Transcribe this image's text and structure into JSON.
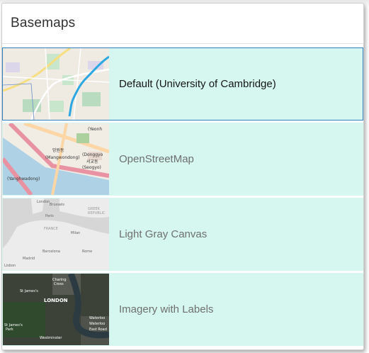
{
  "panel": {
    "title": "Basemaps"
  },
  "basemaps": [
    {
      "label": "Default (University of Cambridge)",
      "selected": true
    },
    {
      "label": "OpenStreetMap",
      "selected": false
    },
    {
      "label": "Light Gray Canvas",
      "selected": false
    },
    {
      "label": "Imagery with Labels",
      "selected": false
    }
  ],
  "thumbnails": {
    "osm": {
      "labels": [
        "(Yeonh",
        "(Mangwondong)",
        "(Seogyo)",
        "(Donggyo",
        "(Yanghwadong)",
        "망원동",
        "서교동"
      ]
    },
    "gray": {
      "labels": [
        "London",
        "Brussels",
        "GREEK",
        "REPUBLIC",
        "Paris",
        "FRANCE",
        "Milan",
        "Barcelona",
        "Rome",
        "Madrid",
        "Lisbon"
      ]
    },
    "imagery": {
      "labels": [
        "Charing",
        "Cross",
        "St James's",
        "LONDON",
        "Waterloo",
        "St James's",
        "Park",
        "Westminster",
        "Waterloo",
        "East Road"
      ]
    }
  },
  "colors": {
    "item_bg": "#d5f7ef",
    "selected_border": "#2f7fbf"
  }
}
